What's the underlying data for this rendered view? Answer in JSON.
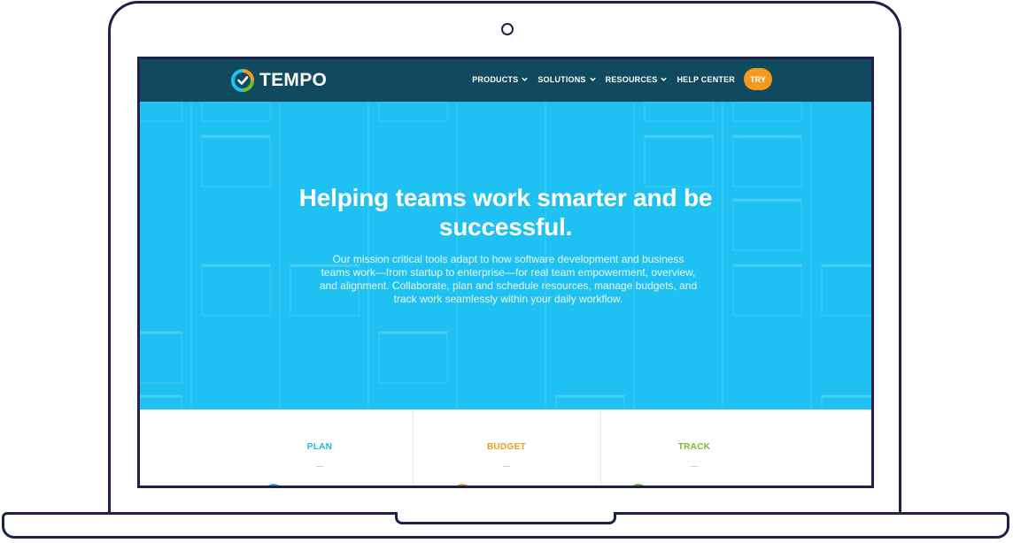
{
  "header": {
    "logo_text": "TEMPO",
    "nav_items": [
      {
        "label": "PRODUCTS",
        "icon": "chevron-down-icon"
      },
      {
        "label": "SOLUTIONS",
        "icon": "chevron-down-icon"
      },
      {
        "label": "RESOURCES",
        "icon": "chevron-down-icon"
      },
      {
        "label": "HELP CENTER"
      }
    ],
    "try_label": "TRY"
  },
  "hero": {
    "title_line1": "Helping teams work smarter and be",
    "title_line2": "successful.",
    "description": "Our mission critical tools adapt to how software development and business teams work—from startup to enterprise—for real team empowerment, overview, and alignment. Collaborate, plan and schedule resources, manage budgets, and track work seamlessly within your daily workflow."
  },
  "features": [
    {
      "label": "PLAN",
      "color": "#1eb6ea"
    },
    {
      "label": "BUDGET",
      "color": "#f39a1f"
    },
    {
      "label": "TRACK",
      "color": "#72be2c"
    }
  ],
  "colors": {
    "navbar": "#114a5e",
    "hero": "#1ec1f2",
    "accent": "#f39a1f",
    "frame": "#1e2149"
  }
}
